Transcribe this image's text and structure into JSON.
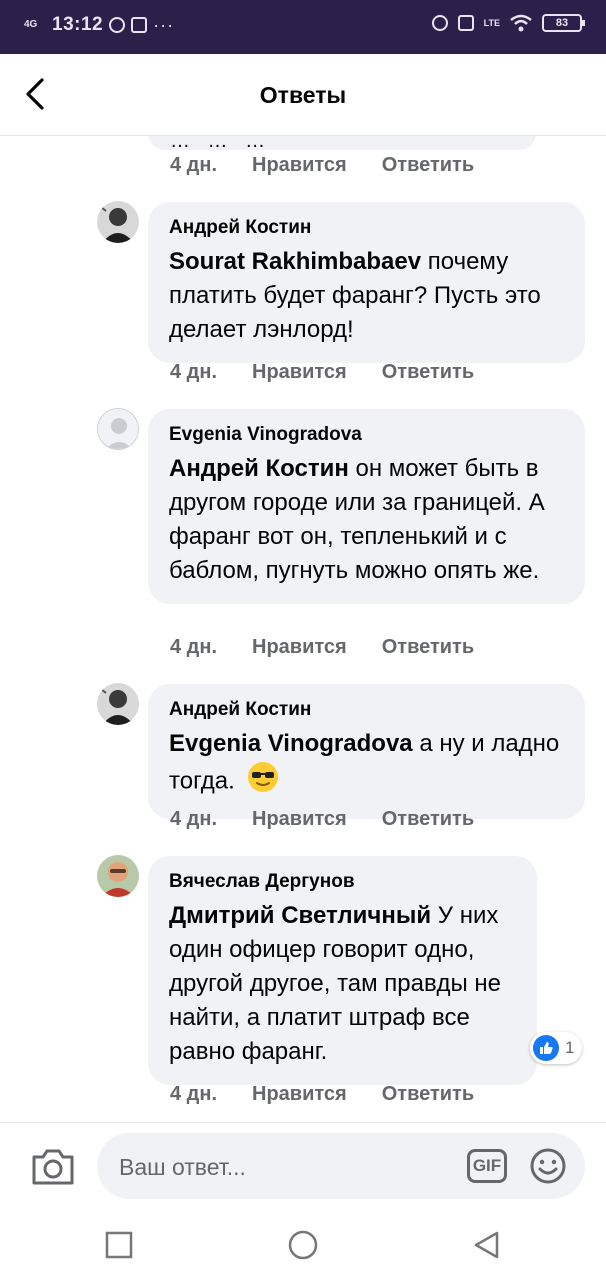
{
  "status_bar": {
    "network": "4G",
    "time": "13:12",
    "more": "···",
    "lte": "LTE",
    "battery": "83"
  },
  "header": {
    "title": "Ответы"
  },
  "actions": {
    "time_label": "4 дн.",
    "like_label": "Нравится",
    "reply_label": "Ответить"
  },
  "cut_comment": {
    "text": "… … …"
  },
  "comments": [
    {
      "author": "Андрей Костин",
      "mention": "Sourat Rakhimbabaev",
      "text": "почему платить будет фаранг? Пусть это делает лэнлорд!",
      "time": "4 дн."
    },
    {
      "author": "Evgenia Vinogradova",
      "mention": "Андрей Костин",
      "text": "он может быть в другом городе или за границей. А фаранг вот он, тепленький и с баблом, пугнуть можно опять же.",
      "time": "4 дн."
    },
    {
      "author": "Андрей Костин",
      "mention": "Evgenia Vinogradova",
      "text": "а ну и ладно тогда.",
      "emoji": "sunglasses-emoji",
      "time": "4 дн."
    },
    {
      "author": "Вячеслав Дергунов",
      "mention": "Дмитрий Светличный",
      "text": "У них один офицер говорит одно, другой другое, там правды не найти, а платит штраф все равно фаранг.",
      "time": "4 дн.",
      "reaction_count": "1"
    }
  ],
  "composer": {
    "placeholder": "Ваш ответ...",
    "gif_label": "GIF"
  },
  "colors": {
    "status_bar_bg": "#2c1f4a",
    "bubble_bg": "#f0f2f5",
    "secondary_text": "#65676b",
    "like_blue": "#1877f2"
  }
}
